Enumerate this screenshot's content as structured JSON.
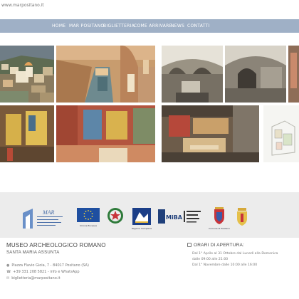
{
  "browser": {
    "url": "www.marpositano.it"
  },
  "nav": {
    "items": [
      "HOME",
      "MAR POSITANO",
      "BIGLIETTERIA",
      "COME ARRIVARE",
      "NEWS",
      "CONTATTI"
    ]
  },
  "gallery": {
    "photos": [
      "Positano village view",
      "Roman corridor with pool",
      "Underground vaulted room",
      "Vaulted room with doorway",
      "Stone vault detail",
      "Fresco wall, yellow panel",
      "Fresco wall, red panels",
      "Fresco wall, yellow and blue",
      "Excavation site",
      "Site map"
    ]
  },
  "logos": {
    "items": [
      "MAR Positano",
      "Unione Europea",
      "Repubblica Italiana",
      "Regione Campania",
      "MiBAC",
      "Soprintendenza Belle Arti",
      "Comune di Positano",
      "Parrocchia"
    ],
    "captions": [
      "Unione Europea",
      "Regione Campania",
      "Comune di Positano"
    ]
  },
  "footer": {
    "title": "MUSEO ARCHEOLOGICO ROMANO",
    "subtitle": "SANTA MARIA ASSUNTA",
    "address": "Piazza Flavio Gioia, 7 - 84017 Positano (SA)",
    "phone": "+39 331 208 5821 - info e WhatsApp",
    "email": "biglietteria@marpositano.it",
    "hours_title": "ORARI DI APERTURA:",
    "hours": [
      "Dal 1° Aprile al 31 Ottobre dal Lunedì alla Domenica",
      "dalle 09:00 alle 21:00",
      "Dal 1° Novembre dalle 10:00 alle 16:00"
    ]
  }
}
